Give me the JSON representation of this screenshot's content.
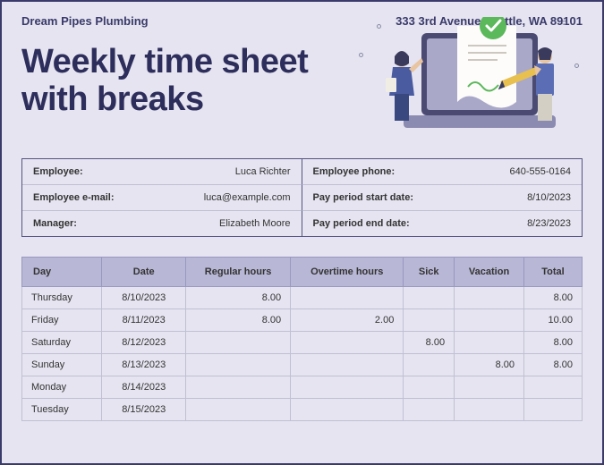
{
  "header": {
    "company": "Dream Pipes Plumbing",
    "address": "333 3rd Avenue Seattle, WA 89101"
  },
  "title": "Weekly time sheet with breaks",
  "info": {
    "employee_label": "Employee:",
    "employee_value": "Luca Richter",
    "phone_label": "Employee phone:",
    "phone_value": "640-555-0164",
    "email_label": "Employee e-mail:",
    "email_value": "luca@example.com",
    "start_label": "Pay period start date:",
    "start_value": "8/10/2023",
    "manager_label": "Manager:",
    "manager_value": "Elizabeth Moore",
    "end_label": "Pay period end date:",
    "end_value": "8/23/2023"
  },
  "table": {
    "headers": [
      "Day",
      "Date",
      "Regular hours",
      "Overtime hours",
      "Sick",
      "Vacation",
      "Total"
    ],
    "rows": [
      {
        "day": "Thursday",
        "date": "8/10/2023",
        "regular": "8.00",
        "overtime": "",
        "sick": "",
        "vacation": "",
        "total": "8.00"
      },
      {
        "day": "Friday",
        "date": "8/11/2023",
        "regular": "8.00",
        "overtime": "2.00",
        "sick": "",
        "vacation": "",
        "total": "10.00"
      },
      {
        "day": "Saturday",
        "date": "8/12/2023",
        "regular": "",
        "overtime": "",
        "sick": "8.00",
        "vacation": "",
        "total": "8.00"
      },
      {
        "day": "Sunday",
        "date": "8/13/2023",
        "regular": "",
        "overtime": "",
        "sick": "",
        "vacation": "8.00",
        "total": "8.00"
      },
      {
        "day": "Monday",
        "date": "8/14/2023",
        "regular": "",
        "overtime": "",
        "sick": "",
        "vacation": "",
        "total": ""
      },
      {
        "day": "Tuesday",
        "date": "8/15/2023",
        "regular": "",
        "overtime": "",
        "sick": "",
        "vacation": "",
        "total": ""
      }
    ]
  }
}
